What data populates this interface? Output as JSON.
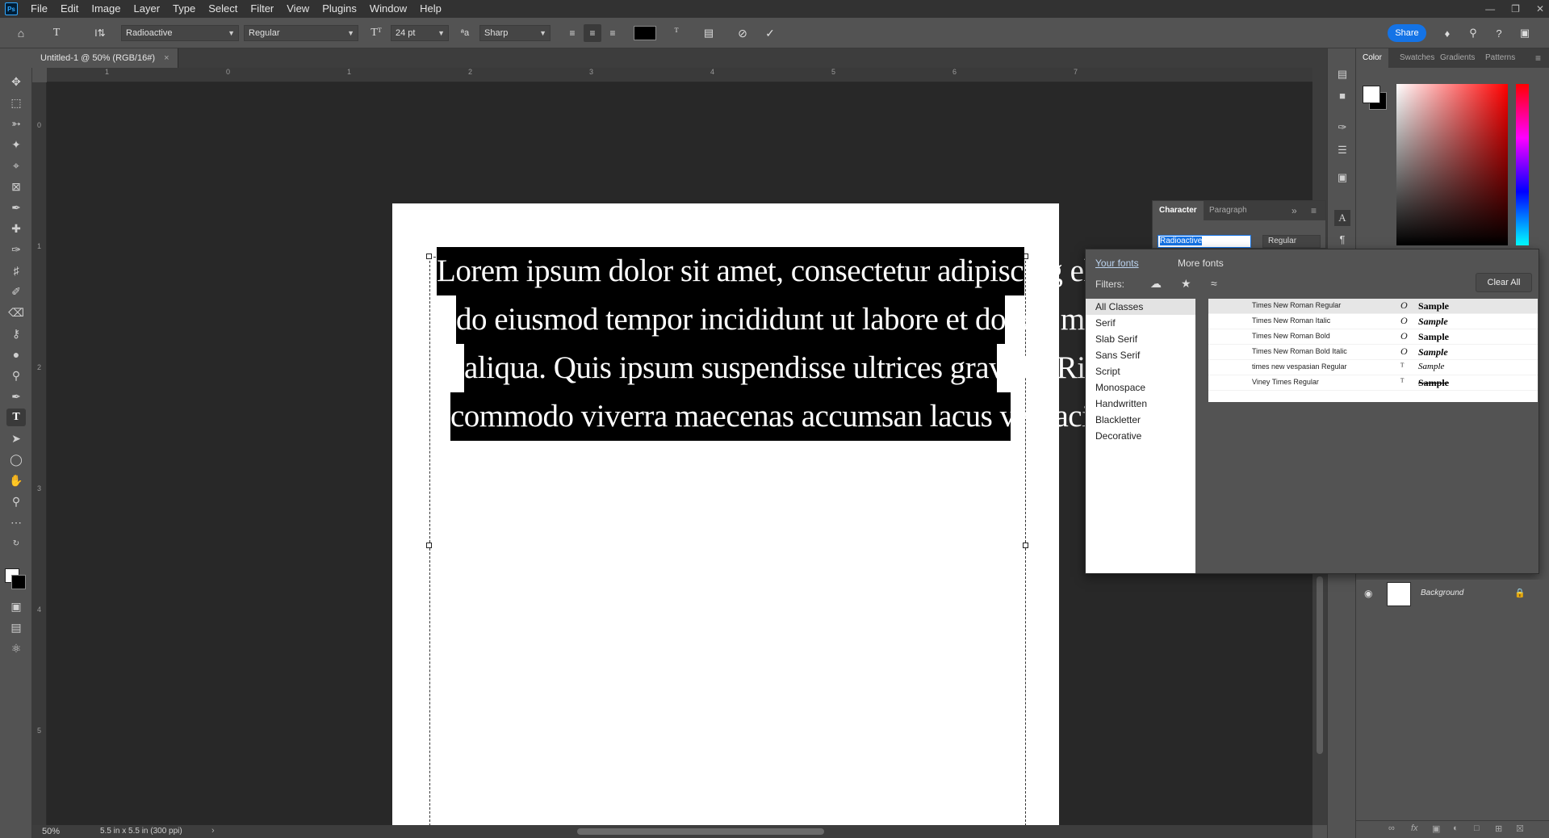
{
  "menubar": {
    "logo": "Ps",
    "items": [
      "File",
      "Edit",
      "Image",
      "Layer",
      "Type",
      "Select",
      "Filter",
      "View",
      "Plugins",
      "Window",
      "Help"
    ]
  },
  "options": {
    "font_family": "Radioactive",
    "font_style": "Regular",
    "font_size": "24 pt",
    "aa_label": "ªa",
    "antialias": "Sharp",
    "text_color": "#000000",
    "share": "Share"
  },
  "document": {
    "tab_title": "Untitled-1 @ 50% (RGB/16#)",
    "text_lines": [
      "Lorem ipsum dolor sit amet, consectetur adipiscing elit, sed",
      "do eiusmod tempor incididunt ut labore et dolore magna",
      "aliqua. Quis ipsum suspendisse ultrices gravida. Risus",
      "commodo viverra maecenas accumsan lacus vel facilisis."
    ]
  },
  "ruler": {
    "h_ticks": [
      "1",
      "0",
      "1",
      "2",
      "3",
      "4",
      "5",
      "6",
      "7"
    ],
    "v_ticks": [
      "0",
      "1",
      "2",
      "3",
      "4",
      "5"
    ]
  },
  "status": {
    "zoom": "50%",
    "doc_info": "5.5 in x 5.5 in (300 ppi)"
  },
  "color_panel": {
    "tabs": [
      "Color",
      "Swatches",
      "Gradients",
      "Patterns"
    ],
    "foreground": "#ffffff",
    "background": "#000000"
  },
  "character_panel": {
    "tabs": [
      "Character",
      "Paragraph"
    ],
    "font_value": "Radioactive",
    "style_value": "Regular"
  },
  "font_dropdown": {
    "tab_your_fonts": "Your fonts",
    "tab_more_fonts": "More fonts",
    "filters_label": "Filters:",
    "clear_all": "Clear All",
    "classes": [
      "All Classes",
      "Serif",
      "Slab Serif",
      "Sans Serif",
      "Script",
      "Monospace",
      "Handwritten",
      "Blackletter",
      "Decorative"
    ],
    "fonts": [
      {
        "name": "Times New Roman Regular",
        "sample": "Sample"
      },
      {
        "name": "Times New Roman Italic",
        "sample": "Sample"
      },
      {
        "name": "Times New Roman Bold",
        "sample": "Sample"
      },
      {
        "name": "Times New Roman Bold Italic",
        "sample": "Sample"
      },
      {
        "name": "times new vespasian Regular",
        "sample": "Sample"
      },
      {
        "name": "Viney Times Regular",
        "sample": "Sample"
      }
    ]
  },
  "layers": {
    "background_name": "Background"
  }
}
